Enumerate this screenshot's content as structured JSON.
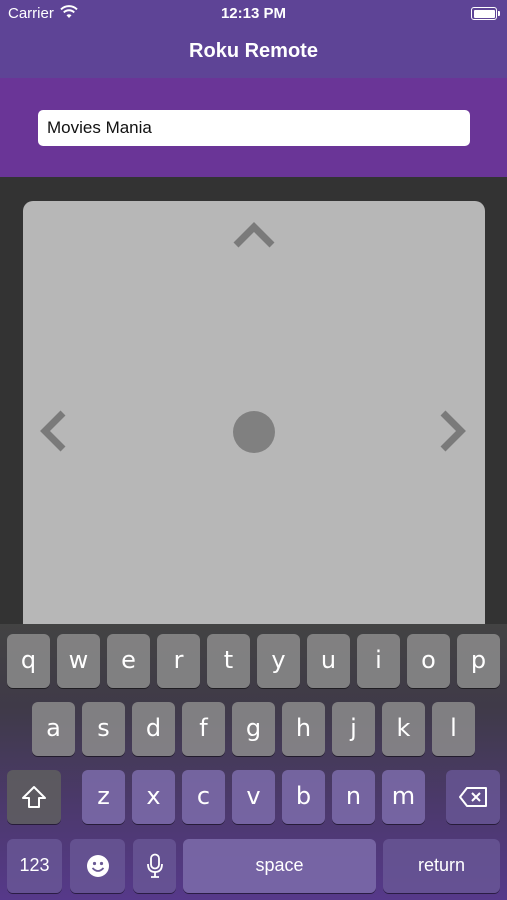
{
  "status_bar": {
    "carrier": "Carrier",
    "time": "12:13 PM"
  },
  "nav": {
    "title": "Roku Remote"
  },
  "search": {
    "value": "Movies Mania"
  },
  "touchpad": {
    "up_icon": "chevron-up-icon",
    "left_icon": "chevron-left-icon",
    "right_icon": "chevron-right-icon",
    "select_icon": "select-dot-icon"
  },
  "keyboard": {
    "row1": [
      "q",
      "w",
      "e",
      "r",
      "t",
      "y",
      "u",
      "i",
      "o",
      "p"
    ],
    "row2": [
      "a",
      "s",
      "d",
      "f",
      "g",
      "h",
      "j",
      "k",
      "l"
    ],
    "row3": [
      "z",
      "x",
      "c",
      "v",
      "b",
      "n",
      "m"
    ],
    "shift_icon": "shift-icon",
    "delete_icon": "delete-icon",
    "numbers_label": "123",
    "emoji_icon": "emoji-icon",
    "mic_icon": "microphone-icon",
    "space_label": "space",
    "return_label": "return"
  },
  "colors": {
    "nav_bg": "#5e4496",
    "header_bg": "#6a3597",
    "pad_bg": "#b7b7b7",
    "body_bg": "#333333"
  }
}
